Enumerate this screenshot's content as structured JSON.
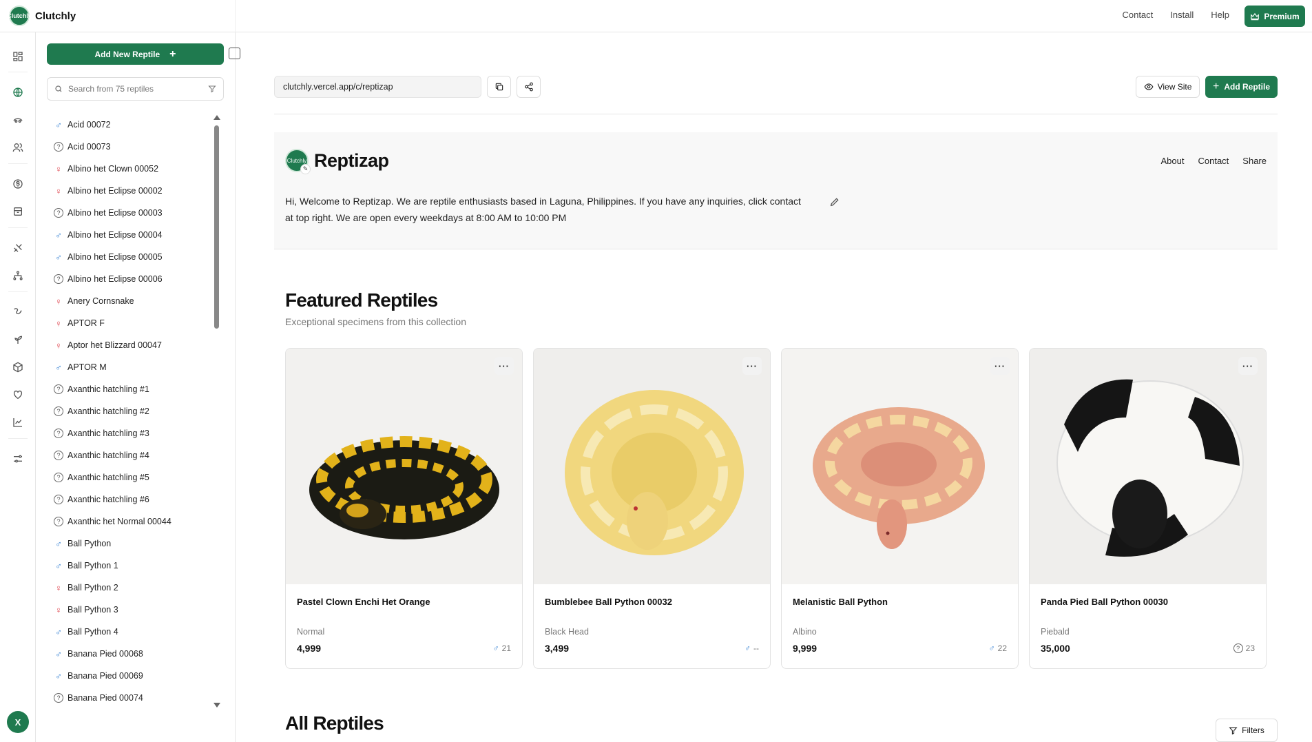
{
  "app": {
    "name": "Clutchly",
    "logo_text": "Clutchly"
  },
  "topnav": {
    "contact": "Contact",
    "install": "Install",
    "help": "Help",
    "premium": "Premium"
  },
  "sidebar": {
    "add_new_label": "Add New Reptile",
    "search_placeholder": "Search from 75 reptiles",
    "items": [
      {
        "name": "Acid 00072",
        "sex": "male"
      },
      {
        "name": "Acid 00073",
        "sex": "unknown"
      },
      {
        "name": "Albino het Clown 00052",
        "sex": "female"
      },
      {
        "name": "Albino het Eclipse 00002",
        "sex": "female"
      },
      {
        "name": "Albino het Eclipse 00003",
        "sex": "unknown"
      },
      {
        "name": "Albino het Eclipse 00004",
        "sex": "male"
      },
      {
        "name": "Albino het Eclipse 00005",
        "sex": "male"
      },
      {
        "name": "Albino het Eclipse 00006",
        "sex": "unknown"
      },
      {
        "name": "Anery Cornsnake",
        "sex": "female"
      },
      {
        "name": "APTOR F",
        "sex": "female"
      },
      {
        "name": "Aptor het Blizzard 00047",
        "sex": "female"
      },
      {
        "name": "APTOR M",
        "sex": "male"
      },
      {
        "name": "Axanthic hatchling #1",
        "sex": "unknown"
      },
      {
        "name": "Axanthic hatchling #2",
        "sex": "unknown"
      },
      {
        "name": "Axanthic hatchling #3",
        "sex": "unknown"
      },
      {
        "name": "Axanthic hatchling #4",
        "sex": "unknown"
      },
      {
        "name": "Axanthic hatchling #5",
        "sex": "unknown"
      },
      {
        "name": "Axanthic hatchling #6",
        "sex": "unknown"
      },
      {
        "name": "Axanthic het Normal 00044",
        "sex": "unknown"
      },
      {
        "name": "Ball Python",
        "sex": "male"
      },
      {
        "name": "Ball Python 1",
        "sex": "male"
      },
      {
        "name": "Ball Python 2",
        "sex": "female"
      },
      {
        "name": "Ball Python 3",
        "sex": "female"
      },
      {
        "name": "Ball Python 4",
        "sex": "male"
      },
      {
        "name": "Banana Pied 00068",
        "sex": "male"
      },
      {
        "name": "Banana Pied 00069",
        "sex": "male"
      },
      {
        "name": "Banana Pied 00074",
        "sex": "unknown"
      }
    ]
  },
  "rail": {
    "avatar_initial": "X"
  },
  "main": {
    "url": "clutchly.vercel.app/c/reptizap",
    "view_site": "View Site",
    "add_reptile": "Add Reptile",
    "hero": {
      "title": "Reptizap",
      "nav": [
        "About",
        "Contact",
        "Share"
      ],
      "description": "Hi, Welcome to Reptizap. We are reptile enthusiasts based in Laguna, Philippines. If you have any inquiries, click contact at top right. We are open every weekdays at 8:00 AM to 10:00 PM"
    },
    "featured": {
      "title": "Featured Reptiles",
      "subtitle": "Exceptional specimens from this collection",
      "more_label": "···",
      "cards": [
        {
          "name": "Pastel Clown Enchi Het Orange",
          "morph": "Normal",
          "price": "4,999",
          "sex_symbol": "♂",
          "meta": "21",
          "sex": "male"
        },
        {
          "name": "Bumblebee Ball Python 00032",
          "morph": "Black Head",
          "price": "3,499",
          "sex_symbol": "♂",
          "meta": "--",
          "sex": "male"
        },
        {
          "name": "Melanistic Ball Python",
          "morph": "Albino",
          "price": "9,999",
          "sex_symbol": "♂",
          "meta": "22",
          "sex": "male"
        },
        {
          "name": "Panda Pied Ball Python 00030",
          "morph": "Piebald",
          "price": "35,000",
          "sex_symbol": "?",
          "meta": "23",
          "sex": "unknown"
        }
      ]
    },
    "all_title": "All Reptiles",
    "filters": "Filters"
  },
  "colors": {
    "brand": "#1f7a4f",
    "male": "#2f7dd1",
    "female": "#e0444e"
  }
}
